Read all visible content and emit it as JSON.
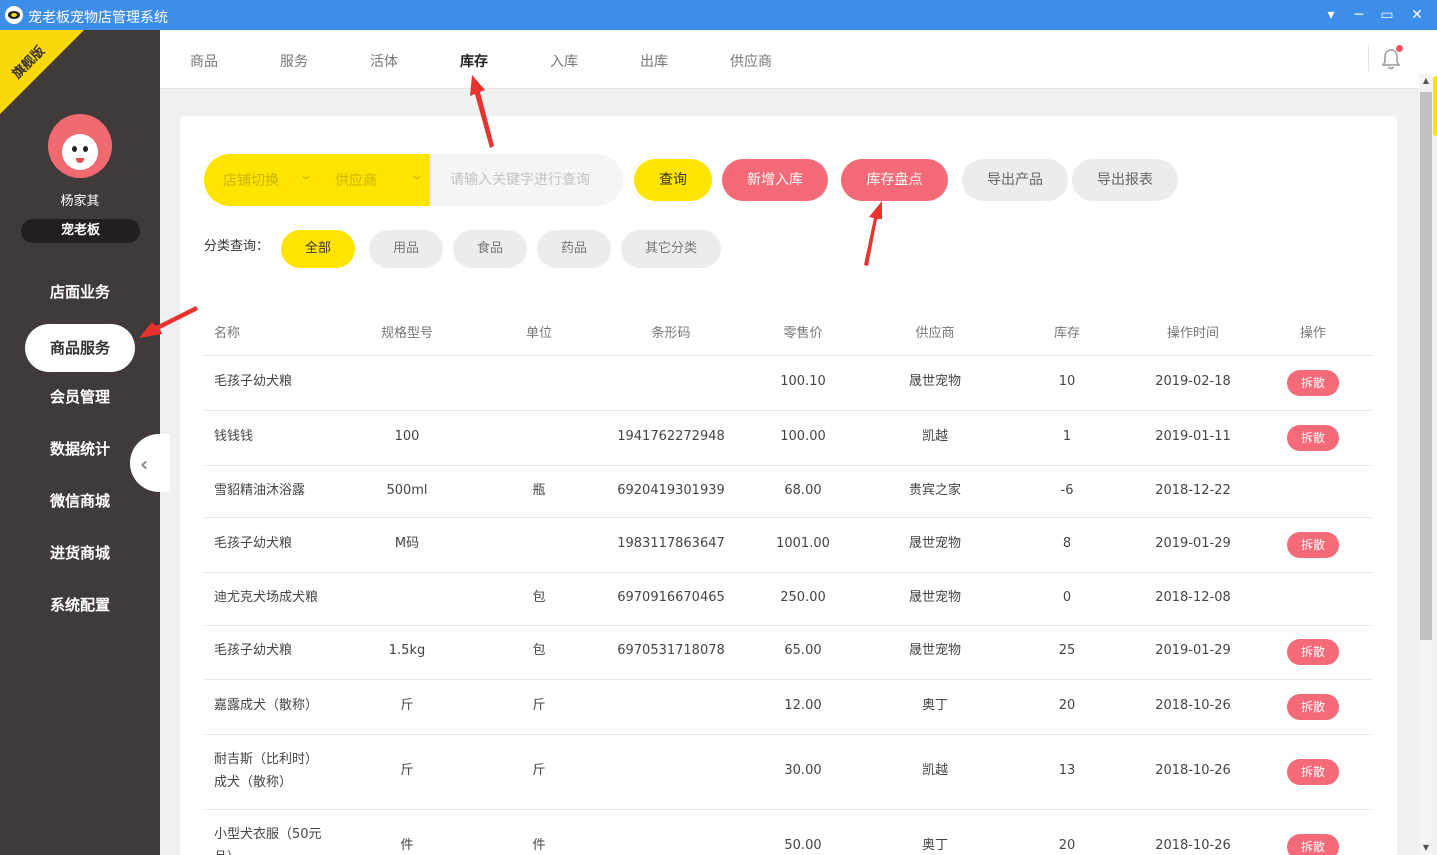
{
  "window": {
    "title": "宠老板宠物店管理系统",
    "controls": [
      "▾",
      "─",
      "▭",
      "✕"
    ]
  },
  "sidebar": {
    "ribbon": "旗舰版",
    "username": "杨家其",
    "role": "宠老板",
    "items": [
      {
        "label": "店面业务"
      },
      {
        "label": "商品服务"
      },
      {
        "label": "会员管理"
      },
      {
        "label": "数据统计"
      },
      {
        "label": "微信商城"
      },
      {
        "label": "进货商城"
      },
      {
        "label": "系统配置"
      }
    ],
    "active_index": 1
  },
  "tabs": [
    {
      "label": "商品"
    },
    {
      "label": "服务"
    },
    {
      "label": "活体"
    },
    {
      "label": "库存"
    },
    {
      "label": "入库"
    },
    {
      "label": "出库"
    },
    {
      "label": "供应商"
    }
  ],
  "active_tab": "库存",
  "toolbar": {
    "store_select": "店铺切换",
    "supplier_select": "供应商",
    "search_placeholder": "请输入关键字进行查询",
    "query_label": "查询",
    "new_stock_in_label": "新增入库",
    "stocktake_label": "库存盘点",
    "export_products_label": "导出产品",
    "export_report_label": "导出报表"
  },
  "categories": {
    "label": "分类查询：",
    "items": [
      "全部",
      "用品",
      "食品",
      "药品",
      "其它分类"
    ],
    "selected": "全部"
  },
  "table": {
    "headers": [
      "名称",
      "规格型号",
      "单位",
      "条形码",
      "零售价",
      "供应商",
      "库存",
      "操作时间",
      "操作"
    ],
    "action_label": "拆散",
    "rows": [
      {
        "name": "毛孩子幼犬粮",
        "spec": "",
        "unit": "",
        "barcode": "",
        "price": "100.10",
        "supplier": "晟世宠物",
        "stock": "10",
        "time": "2019-02-18",
        "action": true
      },
      {
        "name": "钱钱钱",
        "spec": "100",
        "unit": "",
        "barcode": "1941762272948",
        "price": "100.00",
        "supplier": "凯越",
        "stock": "1",
        "time": "2019-01-11",
        "action": true
      },
      {
        "name": "雪貂精油沐浴露",
        "spec": "500ml",
        "unit": "瓶",
        "barcode": "6920419301939",
        "price": "68.00",
        "supplier": "贵宾之家",
        "stock": "-6",
        "time": "2018-12-22",
        "action": false
      },
      {
        "name": "毛孩子幼犬粮",
        "spec": "M码",
        "unit": "",
        "barcode": "1983117863647",
        "price": "1001.00",
        "supplier": "晟世宠物",
        "stock": "8",
        "time": "2019-01-29",
        "action": true
      },
      {
        "name": "迪尤克犬场成犬粮",
        "spec": "",
        "unit": "包",
        "barcode": "6970916670465",
        "price": "250.00",
        "supplier": "晟世宠物",
        "stock": "0",
        "time": "2018-12-08",
        "action": false
      },
      {
        "name": "毛孩子幼犬粮",
        "spec": "1.5kg",
        "unit": "包",
        "barcode": "6970531718078",
        "price": "65.00",
        "supplier": "晟世宠物",
        "stock": "25",
        "time": "2019-01-29",
        "action": true
      },
      {
        "name": "嘉露成犬（散称）",
        "spec": "斤",
        "unit": "斤",
        "barcode": "",
        "price": "12.00",
        "supplier": "奥丁",
        "stock": "20",
        "time": "2018-10-26",
        "action": true
      },
      {
        "name": "耐吉斯（比利时）",
        "name2": "成犬（散称）",
        "spec": "斤",
        "unit": "斤",
        "barcode": "",
        "price": "30.00",
        "supplier": "凯越",
        "stock": "13",
        "time": "2018-10-26",
        "action": true
      },
      {
        "name": "小型犬衣服（50元",
        "name2": "品）",
        "spec": "件",
        "unit": "件",
        "barcode": "",
        "price": "50.00",
        "supplier": "奥丁",
        "stock": "20",
        "time": "2018-10-26",
        "action": true
      }
    ]
  },
  "colors": {
    "titlebar": "#3d8ee8",
    "sidebar": "#403a3b",
    "accent_yellow": "#ffe400",
    "accent_red": "#f56a78",
    "annotation_arrow": "#e8322d"
  }
}
